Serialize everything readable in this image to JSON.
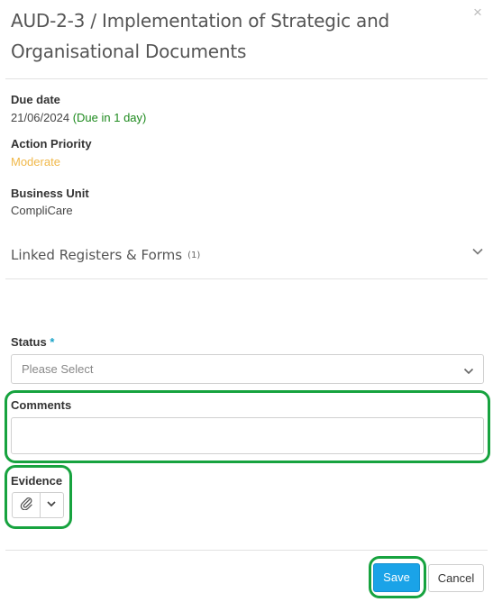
{
  "modal": {
    "title": "AUD-2-3 / Implementation of Strategic and Organisational Documents",
    "close_glyph": "×"
  },
  "details": {
    "due_date_label": "Due date",
    "due_date_value": "21/06/2024",
    "due_date_note": "(Due in 1 day)",
    "priority_label": "Action Priority",
    "priority_value": "Moderate",
    "business_unit_label": "Business Unit",
    "business_unit_value": "CompliCare"
  },
  "linked": {
    "title": "Linked Registers & Forms",
    "count": "(1)"
  },
  "form": {
    "status_label": "Status",
    "required_marker": "*",
    "status_placeholder": "Please Select",
    "comments_label": "Comments",
    "evidence_label": "Evidence"
  },
  "footer": {
    "save_label": "Save",
    "cancel_label": "Cancel"
  },
  "icons": {
    "close": "close-icon",
    "expand": "chevron-down-icon",
    "attach": "paperclip-icon",
    "dropdown": "chevron-down-icon"
  },
  "colors": {
    "accent": "#1aa3e8",
    "due_green": "#1e8a1e",
    "moderate": "#f0b84a",
    "highlight": "#17a33f"
  }
}
